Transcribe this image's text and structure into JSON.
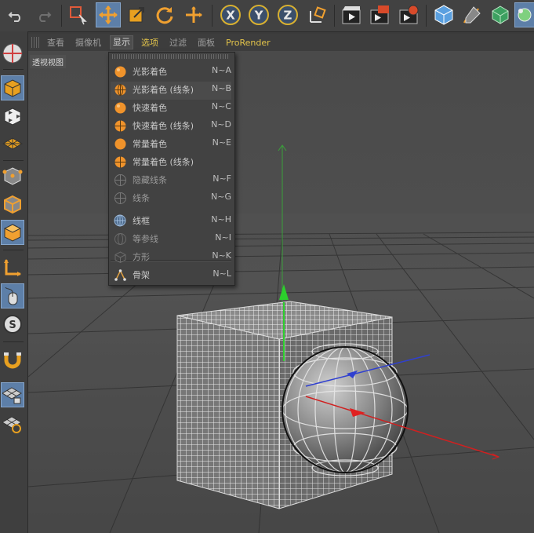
{
  "menubar": {
    "items": [
      "查看",
      "摄像机",
      "显示",
      "选项",
      "过滤",
      "面板",
      "ProRender"
    ]
  },
  "viewport": {
    "label": "透视视图"
  },
  "display_menu": {
    "items": [
      {
        "label": "光影着色",
        "shortcut": "N~A",
        "icon": "orange-sphere-icon"
      },
      {
        "label": "光影着色 (线条)",
        "shortcut": "N~B",
        "icon": "orange-wire-sphere-icon"
      },
      {
        "label": "快速着色",
        "shortcut": "N~C",
        "icon": "orange-sphere-icon"
      },
      {
        "label": "快速着色 (线条)",
        "shortcut": "N~D",
        "icon": "orange-wire-sphere-icon"
      },
      {
        "label": "常量着色",
        "shortcut": "N~E",
        "icon": "orange-sphere-icon"
      },
      {
        "label": "常量着色 (线条)",
        "shortcut": "",
        "icon": "orange-wire-sphere-icon"
      },
      {
        "label": "隐藏线条",
        "shortcut": "N~F",
        "icon": "gray-wire-sphere-icon"
      },
      {
        "label": "线条",
        "shortcut": "N~G",
        "icon": "gray-wire-sphere-icon"
      },
      {
        "label": "线框",
        "shortcut": "N~H",
        "icon": "wireframe-sphere-icon"
      },
      {
        "label": "等参线",
        "shortcut": "N~I",
        "icon": "isoparm-sphere-icon"
      },
      {
        "label": "方形",
        "shortcut": "N~K",
        "icon": "box-icon"
      },
      {
        "label": "骨架",
        "shortcut": "N~L",
        "icon": "skeleton-icon"
      }
    ]
  },
  "colors": {
    "accent": "#5d7fa8",
    "highlight_menu": "#e3c44a",
    "menu_orange": "#f0932b"
  }
}
